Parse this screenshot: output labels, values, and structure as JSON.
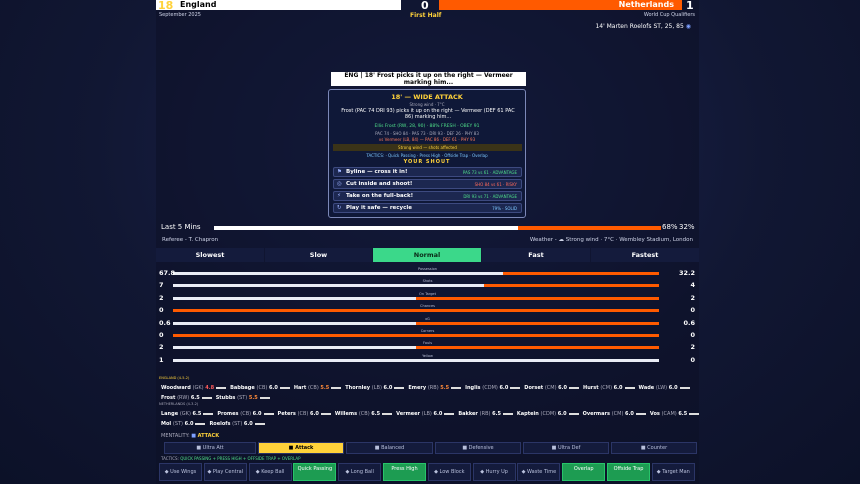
{
  "scoreboard": {
    "home_team": "England",
    "home_score": "18",
    "home_goals": "0",
    "away_team": "Netherlands",
    "away_goals": "1",
    "date": "September 2025",
    "period": "First Half",
    "competition": "World Cup Qualifiers",
    "goal_event": "14' Marten Roelofs ST, 25, 85"
  },
  "commentary": {
    "banner": "ENG | 18' Frost picks it up on the right — Vermeer marking him...",
    "card_title": "18' — WIDE ATTACK",
    "wind": "Strong wind · 7°C",
    "desc": "Frost (PAC 74 DRI 93) picks it up on the right — Vermeer (DEF 61 PAC 86) marking him...",
    "stat1": "Ellis Frost (RW, 28, 90) · 88% FRESH · OBEY 91",
    "stat2": "PAC 74 · SHO 84 · PAS 73 · DRI 93 · DEF 26 · PHY 83",
    "stat3": "vs Vermeer (LB, 84) — PAC 86 · DEF 61 · PHY 93",
    "warning": "Strong wind — shots affected",
    "tactics_line": "TACTICS: · Quick Passing · Press High · Offside Trap · Overlap",
    "prompt": "YOUR SHOUT",
    "options": [
      {
        "label": "Byline — cross it in!",
        "tag": "PAS 73 vs 61 · ADVANTAGE"
      },
      {
        "label": "Cut inside and shoot!",
        "tag": "SHO 84 vs 61 · RISKY"
      },
      {
        "label": "Take on the full-back!",
        "tag": "DRI 93 vs 71 · ADVANTAGE"
      },
      {
        "label": "Play it safe — recycle",
        "tag": "79% · SOLID"
      }
    ]
  },
  "last5": {
    "label": "Last 5 Mins",
    "home_pct": "68%",
    "away_pct": "32%",
    "home_frac": 0.68
  },
  "info": {
    "referee": "Referee - T. Chapron",
    "weather": "Weather - ☁ Strong wind · 7°C · Wembley Stadium, London"
  },
  "speeds": [
    "Slowest",
    "Slow",
    "Normal",
    "Fast",
    "Fastest"
  ],
  "stats": [
    {
      "name": "Possession",
      "home": "67.8",
      "away": "32.2",
      "frac": 0.678
    },
    {
      "name": "Shots",
      "home": "7",
      "away": "4",
      "frac": 0.64
    },
    {
      "name": "On Target",
      "home": "2",
      "away": "2",
      "frac": 0.5
    },
    {
      "name": "Chances",
      "home": "0",
      "away": "0",
      "frac": 0.0
    },
    {
      "name": "xG",
      "home": "0.6",
      "away": "0.6",
      "frac": 0.5
    },
    {
      "name": "Corners",
      "home": "0",
      "away": "0",
      "frac": 0.0
    },
    {
      "name": "Fouls",
      "home": "2",
      "away": "2",
      "frac": 0.5
    },
    {
      "name": "Yellow",
      "home": "1",
      "away": "0",
      "frac": 1.0
    }
  ],
  "lineups": {
    "home_label": "ENGLAND (4-5-2)",
    "home": [
      {
        "name": "Woodward",
        "pos": "(GK)",
        "r": "4.8"
      },
      {
        "name": "Babbage",
        "pos": "(CB)",
        "r": "6.0"
      },
      {
        "name": "Hart",
        "pos": "(CB)",
        "r": "5.5"
      },
      {
        "name": "Thornley",
        "pos": "(LB)",
        "r": "6.0"
      },
      {
        "name": "Emery",
        "pos": "(RB)",
        "r": "5.5"
      },
      {
        "name": "Inglis",
        "pos": "(CDM)",
        "r": "6.0"
      },
      {
        "name": "Dorset",
        "pos": "(CM)",
        "r": "6.0"
      },
      {
        "name": "Hurst",
        "pos": "(CM)",
        "r": "6.0"
      },
      {
        "name": "Wade",
        "pos": "(LW)",
        "r": "6.0"
      },
      {
        "name": "Frost",
        "pos": "(RW)",
        "r": "6.5"
      },
      {
        "name": "Stubbs",
        "pos": "(ST)",
        "r": "5.5"
      }
    ],
    "away_label": "NETHERLANDS (4-3-2)",
    "away": [
      {
        "name": "Lange",
        "pos": "(GK)",
        "r": "6.5"
      },
      {
        "name": "Promes",
        "pos": "(CB)",
        "r": "6.0"
      },
      {
        "name": "Peters",
        "pos": "(CB)",
        "r": "6.0"
      },
      {
        "name": "Willems",
        "pos": "(CB)",
        "r": "6.5"
      },
      {
        "name": "Vermeer",
        "pos": "(LB)",
        "r": "6.0"
      },
      {
        "name": "Bakker",
        "pos": "(RB)",
        "r": "6.5"
      },
      {
        "name": "Kaptein",
        "pos": "(CDM)",
        "r": "6.0"
      },
      {
        "name": "Overmars",
        "pos": "(CM)",
        "r": "6.0"
      },
      {
        "name": "Vos",
        "pos": "(CAM)",
        "r": "6.5"
      },
      {
        "name": "Mol",
        "pos": "(ST)",
        "r": "6.0"
      },
      {
        "name": "Roelofs",
        "pos": "(ST)",
        "r": "6.0"
      }
    ]
  },
  "mentality": {
    "label": "MENTALITY:",
    "current": "ATTACK",
    "options": [
      "Ultra Att",
      "Attack",
      "Balanced",
      "Defensive",
      "Ultra Def",
      "Counter"
    ]
  },
  "tactics": {
    "label": "TACTICS:",
    "current": "QUICK PASSING + PRESS HIGH + OFFSIDE TRAP + OVERLAP",
    "buttons": [
      {
        "label": "Use Wings",
        "on": false
      },
      {
        "label": "Play Central",
        "on": false
      },
      {
        "label": "Keep Ball",
        "on": false
      },
      {
        "label": "Quick Passing",
        "on": true
      },
      {
        "label": "Long Ball",
        "on": false
      },
      {
        "label": "Press High",
        "on": true
      },
      {
        "label": "Low Block",
        "on": false
      },
      {
        "label": "Hurry Up",
        "on": false
      },
      {
        "label": "Waste Time",
        "on": false
      },
      {
        "label": "Overlap",
        "on": true
      },
      {
        "label": "Offside Trap",
        "on": true
      },
      {
        "label": "Target Man",
        "on": false
      }
    ]
  },
  "colors": {
    "home": "#ffffff",
    "away": "#ff5a00",
    "accent": "#ffd23a",
    "active": "#1d9c52",
    "normal_speed": "#3bd88a"
  }
}
